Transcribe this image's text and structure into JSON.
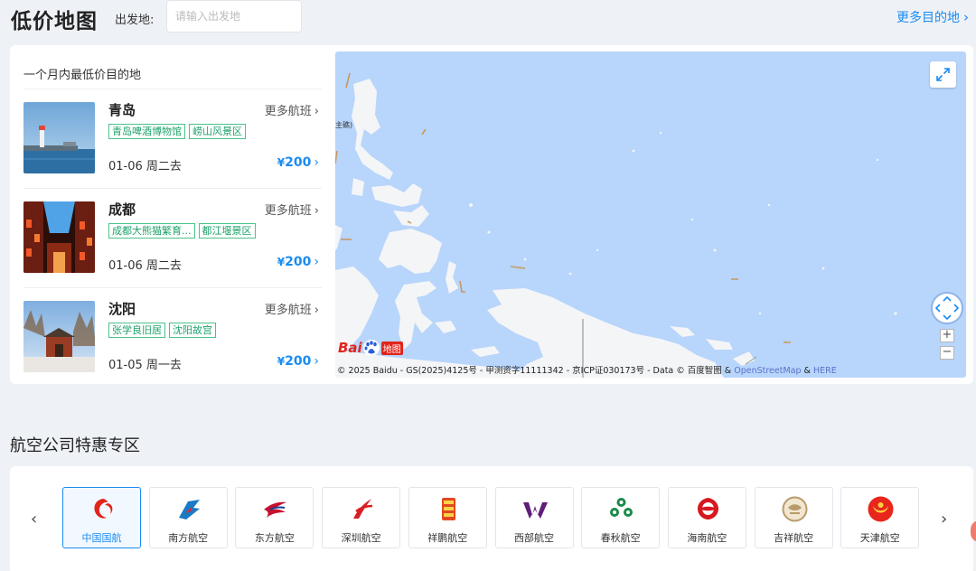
{
  "header": {
    "title": "低价地图",
    "origin_label": "出发地:",
    "origin_placeholder": "请输入出发地",
    "more_destinations": "更多目的地"
  },
  "lowest": {
    "heading": "一个月内最低价目的地",
    "items": [
      {
        "city": "青岛",
        "more": "更多航班",
        "tags": [
          "青岛啤酒博物馆",
          "崂山风景区"
        ],
        "date": "01-06 周二去",
        "currency": "¥",
        "price": "200"
      },
      {
        "city": "成都",
        "more": "更多航班",
        "tags": [
          "成都大熊猫繁育...",
          "都江堰景区"
        ],
        "date": "01-06 周二去",
        "currency": "¥",
        "price": "200"
      },
      {
        "city": "沈阳",
        "more": "更多航班",
        "tags": [
          "张学良旧居",
          "沈阳故宫"
        ],
        "date": "01-05 周一去",
        "currency": "¥",
        "price": "200"
      }
    ]
  },
  "map": {
    "logo_bai": "Bai",
    "logo_ditu": "地图",
    "edge_label": "主礁)",
    "attribution": "© 2025 Baidu - GS(2025)4125号 - 甲测资字11111342 - 京ICP证030173号 - Data © 百度智图 & ",
    "attr_osm": "OpenStreetMap",
    "attr_amp": " & ",
    "attr_here": "HERE",
    "zoom_in": "+",
    "zoom_out": "−",
    "water_color": "#b8d5fb",
    "land_color": "#f4f5f7"
  },
  "airlines": {
    "title": "航空公司特惠专区",
    "list": [
      {
        "name": "中国国航",
        "icon": "air-china-phoenix-icon",
        "color": "#e1251b"
      },
      {
        "name": "南方航空",
        "icon": "china-southern-kapok-icon",
        "color": "#1a7ac4"
      },
      {
        "name": "东方航空",
        "icon": "china-eastern-swallow-icon",
        "color": "#c8102e"
      },
      {
        "name": "深圳航空",
        "icon": "shenzhen-airlines-bird-icon",
        "color": "#d91e24"
      },
      {
        "name": "祥鹏航空",
        "icon": "lucky-air-seal-icon",
        "color": "#e4481e"
      },
      {
        "name": "西部航空",
        "icon": "west-air-w-icon",
        "color": "#5e1e7a"
      },
      {
        "name": "春秋航空",
        "icon": "spring-airlines-clover-icon",
        "color": "#1b8a4a"
      },
      {
        "name": "海南航空",
        "icon": "hainan-airlines-roc-icon",
        "color": "#d6181f"
      },
      {
        "name": "吉祥航空",
        "icon": "juneyao-medallion-icon",
        "color": "#b99b6b"
      },
      {
        "name": "天津航空",
        "icon": "tianjin-airlines-sun-icon",
        "color": "#e8261c"
      }
    ]
  }
}
